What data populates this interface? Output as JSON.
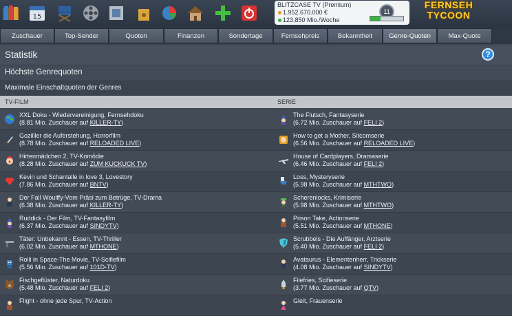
{
  "toolbar": {
    "icons": [
      "books-icon",
      "calendar-icon",
      "directors-chair-icon",
      "film-reel-icon",
      "picture-frame-icon",
      "bag-icon",
      "pie-chart-icon",
      "house-icon",
      "plus-icon",
      "power-icon"
    ]
  },
  "status": {
    "channel": "BLITZCASE TV (Premium)",
    "money": "1.952.670.000 €",
    "viewers": "123,850 Mio./Woche",
    "badge": "11",
    "progress": 0.32
  },
  "logo": {
    "line1": "FERNSEH",
    "line2": "TYCOON"
  },
  "tabs": [
    {
      "label": "Zuschauer",
      "active": false
    },
    {
      "label": "Top-Sender",
      "active": false
    },
    {
      "label": "Quoten",
      "active": false
    },
    {
      "label": "Finanzen",
      "active": false
    },
    {
      "label": "Sondertage",
      "active": false
    },
    {
      "label": "Fernsehpreis",
      "active": false
    },
    {
      "label": "Bekanntheit",
      "active": false
    },
    {
      "label": "Genre-Quoten",
      "active": true
    },
    {
      "label": "Max-Quote",
      "active": false
    }
  ],
  "page": {
    "title": "Statistik",
    "help_label": "?",
    "section": "Höchste Genrequoten",
    "subsection": "Maximale Einschaltquoten der Genres"
  },
  "columns": {
    "left": "TV-FILM",
    "right": "SERIE"
  },
  "rows": [
    {
      "left": {
        "title": "XXL Doku - Wiedervereinigung, Fernsehdoku",
        "pre": "(8.81 Mio. Zuschauer auf ",
        "sender": "KILLER-TY",
        "post": ")",
        "icon": "globe-icon"
      },
      "right": {
        "title": "The Flutsch, Fantasyserie",
        "pre": "(6.72 Mio. Zuschauer auf ",
        "sender": "FELI 2",
        "post": ")",
        "icon": "wizard-icon"
      }
    },
    {
      "left": {
        "title": "Gozilller die Auferstehung, Horrorfilm",
        "pre": "(8.78 Mio. Zuschauer auf ",
        "sender": "RELOADED LIVE",
        "post": ")",
        "icon": "knife-icon"
      },
      "right": {
        "title": "How to get a Mother, Sitcomserie",
        "pre": "(6.56 Mio. Zuschauer auf ",
        "sender": "RELOADED LIVE",
        "post": ")",
        "icon": "jester-icon"
      }
    },
    {
      "left": {
        "title": "Hirtenmädchen 2, TV-Komödie",
        "pre": "(8.28 Mio. Zuschauer auf ",
        "sender": "ZUM KUCKUCK TV",
        "post": ")",
        "icon": "clown-icon"
      },
      "right": {
        "title": "House of Cardplayers, Dramaserie",
        "pre": "(6.46 Mio. Zuschauer auf ",
        "sender": "FELI 2",
        "post": ")",
        "icon": "airplane-icon"
      }
    },
    {
      "left": {
        "title": "Kevin und Schantalle in love 3, Lovestory",
        "pre": "(7.86 Mio. Zuschauer auf ",
        "sender": "BNTV",
        "post": ")",
        "icon": "heart-icon"
      },
      "right": {
        "title": "Loss, Mysteryserie",
        "pre": "(5.98 Mio. Zuschauer auf ",
        "sender": "MTHTWO",
        "post": ")",
        "icon": "toilet-icon"
      }
    },
    {
      "left": {
        "title": "Der Fall Woulffy-Vom Präsi zum Betrüge, TV-Drama",
        "pre": "(6.38 Mio. Zuschauer auf ",
        "sender": "KILLER-TY",
        "post": ")",
        "icon": "person-icon"
      },
      "right": {
        "title": "Scherenlocks, Krimiserie",
        "pre": "(5.98 Mio. Zuschauer auf ",
        "sender": "MTHTWO",
        "post": ")",
        "icon": "detective-icon"
      }
    },
    {
      "left": {
        "title": "Ruddick - Der Film, TV-Fantasyfilm",
        "pre": "(6.37 Mio. Zuschauer auf ",
        "sender": "SINDYTV",
        "post": ")",
        "icon": "wizard-icon"
      },
      "right": {
        "title": "Prison Take, Actionserie",
        "pre": "(5.51 Mio. Zuschauer auf ",
        "sender": "MTHONE",
        "post": ")",
        "icon": "fighter-icon"
      }
    },
    {
      "left": {
        "title": "Täter: Unbekannt - Essen, TV-Thriller",
        "pre": "(6.02 Mio. Zuschauer auf ",
        "sender": "MTHONE",
        "post": ")",
        "icon": "gun-icon"
      },
      "right": {
        "title": "Scrubbels - Die Auffänger, Arztserie",
        "pre": "(5.40 Mio. Zuschauer auf ",
        "sender": "FELI 2",
        "post": ")",
        "icon": "shield-icon"
      }
    },
    {
      "left": {
        "title": "Rolli in Space-The Movie, TV-Scifiefilm",
        "pre": "(5.56 Mio. Zuschauer auf ",
        "sender": "101D-TV",
        "post": ")",
        "icon": "robot-icon"
      },
      "right": {
        "title": "Avataurus - Elementenherr, Trickserie",
        "pre": "(4.08 Mio. Zuschauer auf ",
        "sender": "SINDYTV",
        "post": ")",
        "icon": "cartoon-icon"
      }
    },
    {
      "left": {
        "title": "Fischgeflüster, Naturdoku",
        "pre": "(5.48 Mio. Zuschauer auf ",
        "sender": "FELI 2",
        "post": ")",
        "icon": "bear-icon"
      },
      "right": {
        "title": "Filefries, Scifieserie",
        "pre": "(3.77 Mio. Zuschauer auf ",
        "sender": "QTV",
        "post": ")",
        "icon": "rocket-icon"
      }
    },
    {
      "left": {
        "title": "Flight - ohne jede Spur, TV-Action",
        "pre": "",
        "sender": "",
        "post": "",
        "icon": "fighter-icon"
      },
      "right": {
        "title": "Gleit, Frauenserie",
        "pre": "",
        "sender": "",
        "post": "",
        "icon": "woman-icon"
      }
    }
  ]
}
